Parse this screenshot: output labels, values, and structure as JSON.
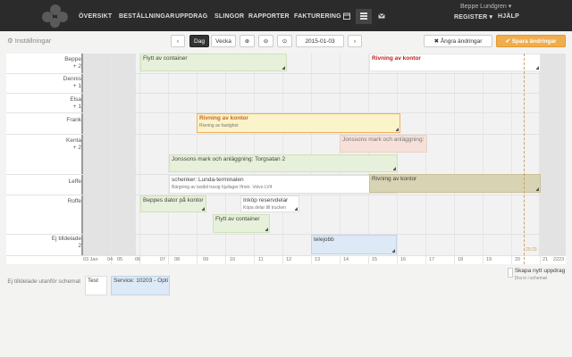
{
  "nav": {
    "items": [
      "ÖVERSIKT",
      "BESTÄLLNINGAR",
      "UPPDRAG",
      "SLINGOR",
      "RAPPORTER",
      "FAKTURERING"
    ],
    "user": "Beppe Lundgren ▾",
    "register": "REGISTER ▾",
    "help": "HJÄLP"
  },
  "toolbar": {
    "settings": "⚙ Inställningar",
    "prev": "‹",
    "day": "Dag",
    "week": "Vecka",
    "zoom_in": "⊕",
    "zoom_out": "⊖",
    "today": "⊙",
    "date": "2015-01-03",
    "next": "›",
    "undo": "✖ Ångra ändringar",
    "save": "✔ Spara ändringar"
  },
  "rows": [
    {
      "name": "Beppe",
      "extra": "+ 2"
    },
    {
      "name": "Dennis",
      "extra": "+ 1"
    },
    {
      "name": "Elsa",
      "extra": "+ 1"
    },
    {
      "name": "Frank",
      "extra": ""
    },
    {
      "name": "Kenta",
      "extra": "+ 2"
    },
    {
      "name": "Leffe",
      "extra": ""
    },
    {
      "name": "Roffe",
      "extra": ""
    },
    {
      "name": "Ej tilldelade",
      "extra": "2"
    }
  ],
  "hours": [
    "03 Jan",
    "04",
    "05",
    "06",
    "07",
    "08",
    "09",
    "10",
    "11",
    "12",
    "13",
    "14",
    "15",
    "16",
    "17",
    "18",
    "19",
    "20",
    "21",
    "22",
    "23"
  ],
  "events": [
    {
      "title": "Flytt av container",
      "sub": ""
    },
    {
      "title": "Rivning av kontor",
      "sub": ""
    },
    {
      "title": "Rivning av kontor",
      "sub": "Rivning av fastighet"
    },
    {
      "title": "Jonssons mark och anläggning:",
      "sub": ""
    },
    {
      "title": "Jonssons mark och anläggning: Torgsatan 2",
      "sub": ""
    },
    {
      "title": "schenker: Lunda-terminalen",
      "sub": "Bärgning av lastbil trasig hjullager Ifrom. Volvo LV4"
    },
    {
      "title": "Rivning av kontor",
      "sub": ""
    },
    {
      "title": "Beppes dator på kontor",
      "sub": ""
    },
    {
      "title": "Inköp reservdelar",
      "sub": "Köpa delar till trucken"
    },
    {
      "title": "Flytt av container",
      "sub": ""
    },
    {
      "title": "telejobb",
      "sub": ""
    }
  ],
  "current_time": "20:23",
  "unscheduled": {
    "label": "Ej tilldelade utanför schemat",
    "items": [
      "Test",
      "Service: 10203 - Opti"
    ],
    "create": "Skapa nytt uppdrag",
    "drag_hint": "Dra in i schemat"
  }
}
